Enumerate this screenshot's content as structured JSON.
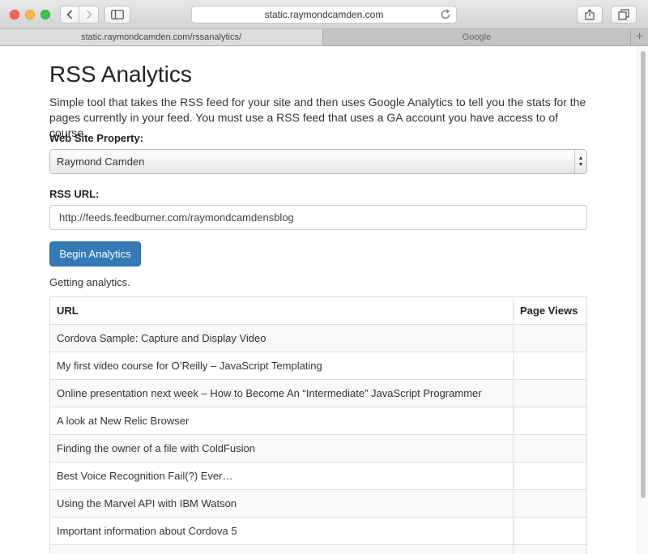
{
  "browser": {
    "address": "static.raymondcamden.com",
    "tabs": [
      {
        "label": "static.raymondcamden.com/rssanalytics/"
      },
      {
        "label": "Google"
      }
    ],
    "new_tab_label": "+"
  },
  "page": {
    "title": "RSS Analytics",
    "intro": "Simple tool that takes the RSS feed for your site and then uses Google Analytics to tell you the stats for the pages currently in your feed. You must use a RSS feed that uses a GA account you have access to of course.",
    "property_label": "Web Site Property:",
    "property_value": "Raymond Camden",
    "rss_label": "RSS URL:",
    "rss_value": "http://feeds.feedburner.com/raymondcamdensblog",
    "begin_button": "Begin Analytics",
    "status": "Getting analytics.",
    "table": {
      "headers": [
        "URL",
        "Page Views"
      ],
      "rows": [
        {
          "url": "Cordova Sample: Capture and Display Video",
          "views": ""
        },
        {
          "url": "My first video course for O’Reilly – JavaScript Templating",
          "views": ""
        },
        {
          "url": "Online presentation next week – How to Become An “Intermediate” JavaScript Programmer",
          "views": ""
        },
        {
          "url": "A look at New Relic Browser",
          "views": ""
        },
        {
          "url": "Finding the owner of a file with ColdFusion",
          "views": ""
        },
        {
          "url": "Best Voice Recognition Fail(?) Ever…",
          "views": ""
        },
        {
          "url": "Using the Marvel API with IBM Watson",
          "views": ""
        },
        {
          "url": "Important information about Cordova 5",
          "views": ""
        },
        {
          "url": "",
          "views": ""
        }
      ]
    }
  },
  "colors": {
    "primary_button": "#337ab7",
    "close": "#fc605c",
    "minimize": "#fdbc40",
    "maximize": "#34c84a"
  }
}
